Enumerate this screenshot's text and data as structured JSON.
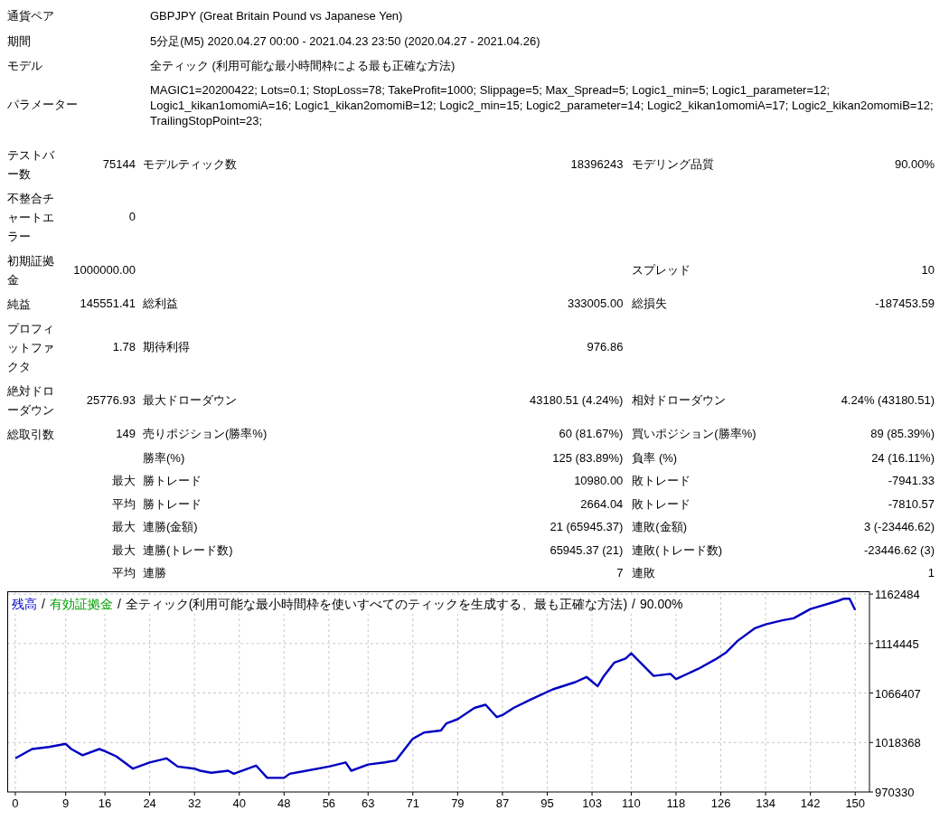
{
  "summary": [
    {
      "label": "通貨ペア",
      "value": "GBPJPY (Great Britain Pound vs Japanese Yen)"
    },
    {
      "label": "期間",
      "value": "5分足(M5) 2020.04.27 00:00 - 2021.04.23 23:50 (2020.04.27 - 2021.04.26)"
    },
    {
      "label": "モデル",
      "value": "全ティック (利用可能な最小時間枠による最も正確な方法)"
    },
    {
      "label": "パラメーター",
      "value": "MAGIC1=20200422; Lots=0.1; StopLoss=78; TakeProfit=1000; Slippage=5; Max_Spread=5; Logic1_min=5; Logic1_parameter=12; Logic1_kikan1omomiA=16; Logic1_kikan2omomiB=12; Logic2_min=15; Logic2_parameter=14; Logic2_kikan1omomiA=17; Logic2_kikan2omomiB=12; TrailingStopPoint=23;"
    }
  ],
  "stats": [
    {
      "label_1": "テストバー数",
      "value_1": "75144",
      "label_2": "モデルティック数",
      "value_2": "18396243",
      "label_3": "モデリング品質",
      "value_3": "90.00%"
    },
    {
      "label_1": "不整合チャートエラー",
      "value_1": "0"
    },
    {
      "label_1": "初期証拠金",
      "value_1": "1000000.00",
      "label_3": "スプレッド",
      "value_3": "10"
    },
    {
      "label_1": "純益",
      "value_1": "145551.41",
      "label_2": "総利益",
      "value_2": "333005.00",
      "label_3": "総損失",
      "value_3": "-187453.59"
    },
    {
      "label_1": "プロフィットファクタ",
      "value_1": "1.78",
      "label_2": "期待利得",
      "value_2": "976.86"
    },
    {
      "label_1": "絶対ドローダウン",
      "value_1": "25776.93",
      "label_2": "最大ドローダウン",
      "value_2": "43180.51 (4.24%)",
      "label_3": "相対ドローダウン",
      "value_3": "4.24% (43180.51)"
    },
    {
      "label_1": "総取引数",
      "value_1": "149",
      "label_2": "売りポジション(勝率%)",
      "value_2": "60 (81.67%)",
      "label_3": "買いポジション(勝率%)",
      "value_3": "89 (85.39%)"
    },
    {
      "label_2": "勝率(%)",
      "value_2": "125 (83.89%)",
      "label_3": "負率 (%)",
      "value_3": "24 (16.11%)"
    },
    {
      "value_1": "最大",
      "label_2": "勝トレード",
      "value_2": "10980.00",
      "label_3": "敗トレード",
      "value_3": "-7941.33"
    },
    {
      "value_1": "平均",
      "label_2": "勝トレード",
      "value_2": "2664.04",
      "label_3": "敗トレード",
      "value_3": "-7810.57"
    },
    {
      "value_1": "最大",
      "label_2": "連勝(金額)",
      "value_2": "21 (65945.37)",
      "label_3": "連敗(金額)",
      "value_3": "3 (-23446.62)"
    },
    {
      "value_1": "最大",
      "label_2": "連勝(トレード数)",
      "value_2": "65945.37 (21)",
      "label_3": "連敗(トレード数)",
      "value_3": "-23446.62 (3)"
    },
    {
      "value_1": "平均",
      "label_2": "連勝",
      "value_2": "7",
      "label_3": "連敗",
      "value_3": "1"
    }
  ],
  "chart": {
    "legend_separator": "/",
    "legend": [
      {
        "text": "有効証拠金",
        "color": "#00a000"
      },
      {
        "text": "全ティック(利用可能な最小時間枠を使いすべてのティックを生成する、最も正確な方法)",
        "color": "#000000"
      },
      {
        "text": "90.00%",
        "color": "#000000"
      }
    ],
    "chart_data": {
      "type": "line",
      "x": [
        0,
        3,
        6,
        9,
        10,
        12,
        15,
        16,
        18,
        21,
        24,
        27,
        29,
        32,
        33,
        35,
        38,
        39,
        43,
        45,
        48,
        49,
        52,
        56,
        59,
        60,
        63,
        66,
        68,
        71,
        73,
        76,
        77,
        79,
        82,
        84,
        86,
        87,
        89,
        92,
        96,
        100,
        102,
        104,
        105,
        107,
        109,
        110,
        114,
        117,
        118,
        122,
        125,
        127,
        129,
        132,
        134,
        137,
        139,
        142,
        147,
        148,
        149,
        150
      ],
      "series": [
        {
          "name": "残高",
          "color": "#0000c0",
          "values": [
            1003000,
            1012000,
            1014000,
            1017000,
            1012000,
            1006000,
            1012000,
            1010000,
            1005000,
            993000,
            999000,
            1003000,
            995000,
            993000,
            991000,
            989000,
            991000,
            988000,
            996000,
            984000,
            984000,
            988000,
            991000,
            995000,
            999000,
            991000,
            997000,
            999000,
            1001000,
            1022000,
            1028000,
            1030000,
            1037000,
            1041000,
            1052000,
            1055000,
            1043000,
            1045000,
            1052000,
            1060000,
            1070000,
            1077000,
            1082000,
            1073000,
            1082000,
            1096000,
            1100000,
            1105000,
            1083000,
            1085000,
            1080000,
            1090000,
            1099000,
            1106000,
            1117000,
            1129000,
            1133000,
            1137000,
            1139000,
            1148000,
            1156000,
            1158000,
            1158000,
            1147000
          ]
        }
      ],
      "grid": true,
      "xticks": [
        0,
        9,
        16,
        24,
        32,
        40,
        48,
        56,
        63,
        71,
        79,
        87,
        95,
        103,
        110,
        118,
        126,
        134,
        142,
        150
      ],
      "yticks": [
        970330,
        1018368,
        1066407,
        1114445,
        1162484
      ],
      "xlim": [
        -0.8,
        151.9
      ],
      "ylim": [
        970330,
        1163450
      ]
    }
  }
}
